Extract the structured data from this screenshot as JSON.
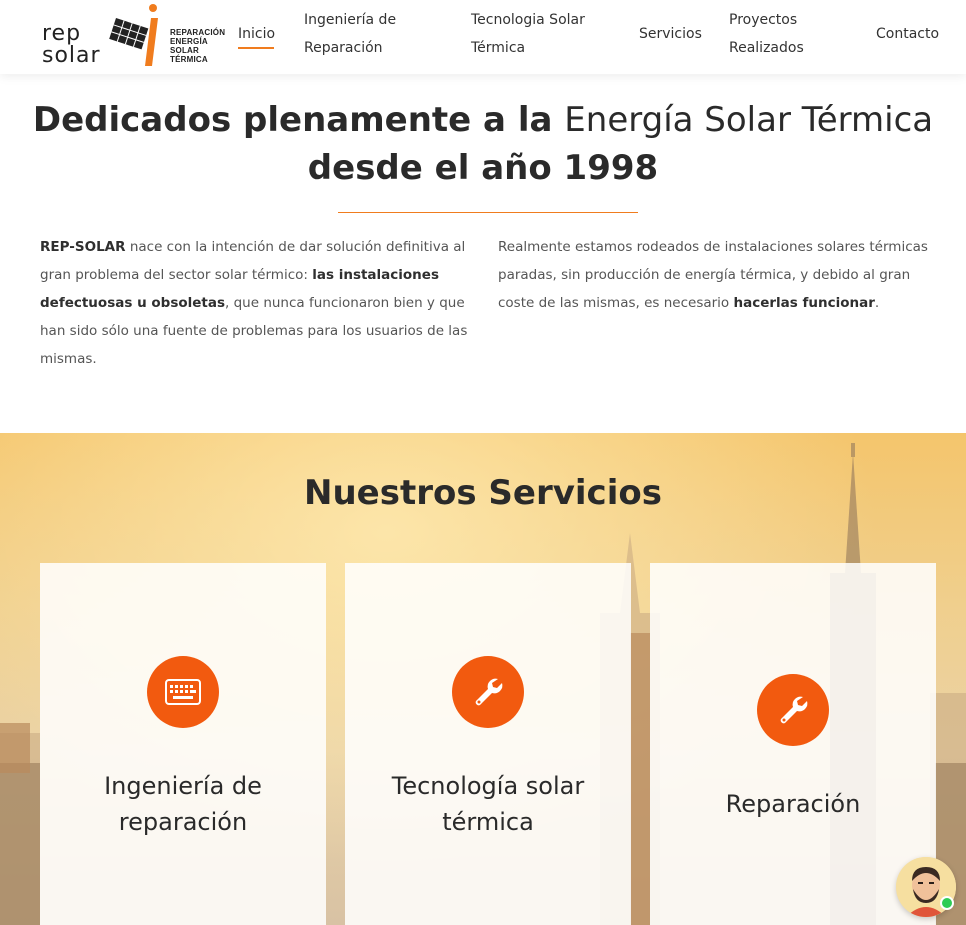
{
  "brand": {
    "logo_text_top": "rep",
    "logo_text_bottom": "solar",
    "logo_sub": [
      "REPARACIÓN",
      "ENERGÍA",
      "SOLAR",
      "TÉRMICA"
    ],
    "accent_color": "#f07c1e",
    "icon_color": "#f25a0f"
  },
  "nav": {
    "items": [
      {
        "label_1": "Inicio",
        "label_2": ""
      },
      {
        "label_1": "Ingeniería de",
        "label_2": "Reparación"
      },
      {
        "label_1": "Tecnologia Solar",
        "label_2": "Térmica"
      },
      {
        "label_1": "Servicios",
        "label_2": ""
      },
      {
        "label_1": "Proyectos",
        "label_2": "Realizados"
      },
      {
        "label_1": "Contacto",
        "label_2": ""
      }
    ]
  },
  "intro": {
    "title_bold_1": "Dedicados plenamente a la",
    "title_light": "Energía Solar Térmica",
    "title_bold_2": "desde el año 1998",
    "left": {
      "brand": "REP-SOLAR",
      "text_1": " nace con la intención de dar solución definitiva al gran problema del sector solar térmico: ",
      "bold_1": "las instalaciones defectuosas u obsoletas",
      "text_2": ", que nunca funcionaron bien y que han sido sólo una fuente de problemas para los usuarios de las mismas."
    },
    "right": {
      "text_1": "Realmente estamos rodeados de instalaciones solares térmicas paradas, sin producción de energía térmica, y debido al gran coste de las mismas, es necesario ",
      "bold_1": "hacerlas funcionar",
      "text_2": "."
    }
  },
  "services": {
    "title": "Nuestros Servicios",
    "cards": [
      {
        "title_1": "Ingeniería de",
        "title_2": "reparación",
        "icon": "keyboard-icon"
      },
      {
        "title_1": "Tecnología solar",
        "title_2": "térmica",
        "icon": "wrench-icon"
      },
      {
        "title_1": "Reparación",
        "title_2": "",
        "icon": "wrench-icon"
      }
    ]
  },
  "chat": {
    "icon": "chat-avatar-icon",
    "status_color": "#2ecc55"
  }
}
